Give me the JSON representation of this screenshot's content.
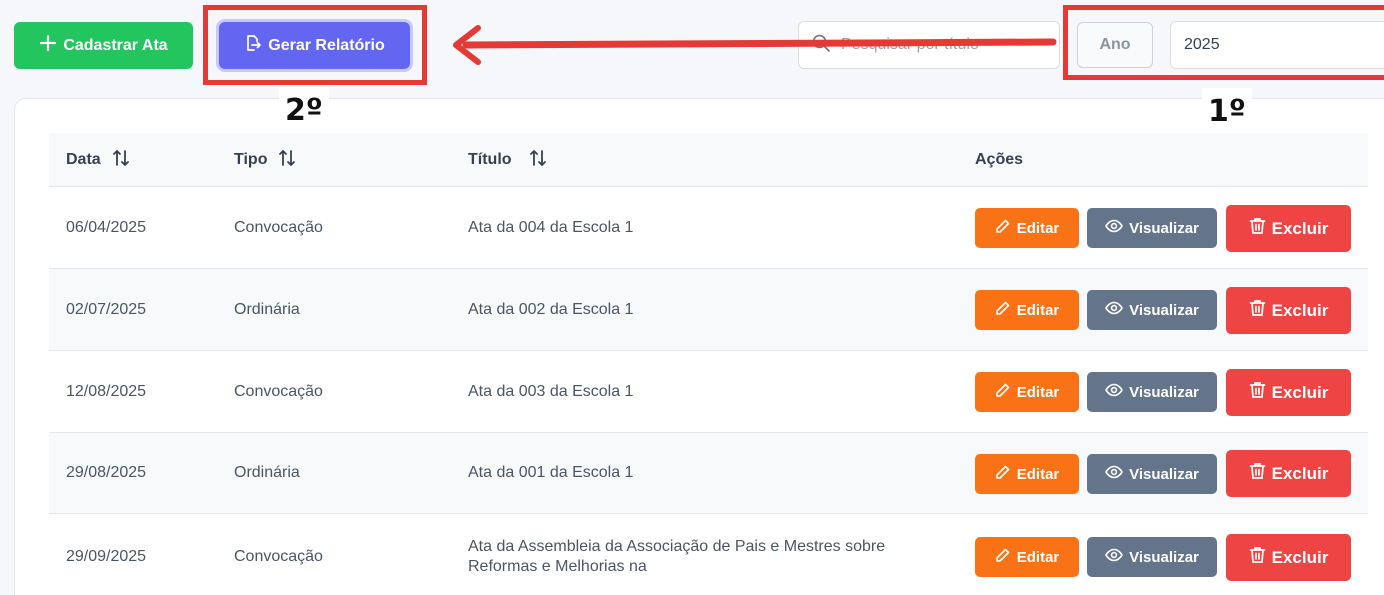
{
  "toolbar": {
    "cadastrar_label": "Cadastrar Ata",
    "gerar_label": "Gerar Relatório",
    "search_placeholder": "Pesquisar por título",
    "ano_label": "Ano",
    "year_value": "2025"
  },
  "annotations": {
    "step_1": "1º",
    "step_2": "2º"
  },
  "table": {
    "columns": [
      "Data",
      "Tipo",
      "Título",
      "Ações"
    ],
    "actions": {
      "edit": "Editar",
      "view": "Visualizar",
      "delete": "Excluir"
    },
    "rows": [
      {
        "data": "06/04/2025",
        "tipo": "Convocação",
        "titulo": "Ata da 004 da Escola 1"
      },
      {
        "data": "02/07/2025",
        "tipo": "Ordinária",
        "titulo": "Ata da 002 da Escola 1"
      },
      {
        "data": "12/08/2025",
        "tipo": "Convocação",
        "titulo": "Ata da 003 da Escola 1"
      },
      {
        "data": "29/08/2025",
        "tipo": "Ordinária",
        "titulo": "Ata da 001 da Escola 1"
      },
      {
        "data": "29/09/2025",
        "tipo": "Convocação",
        "titulo": "Ata da Assembleia da Associação de Pais e Mestres sobre Reformas e Melhorias na"
      }
    ]
  },
  "colors": {
    "green": "#22c55e",
    "indigo": "#6366f1",
    "orange": "#f97316",
    "slate": "#64748b",
    "red": "#ef4444",
    "annotation_red": "#e53935"
  }
}
